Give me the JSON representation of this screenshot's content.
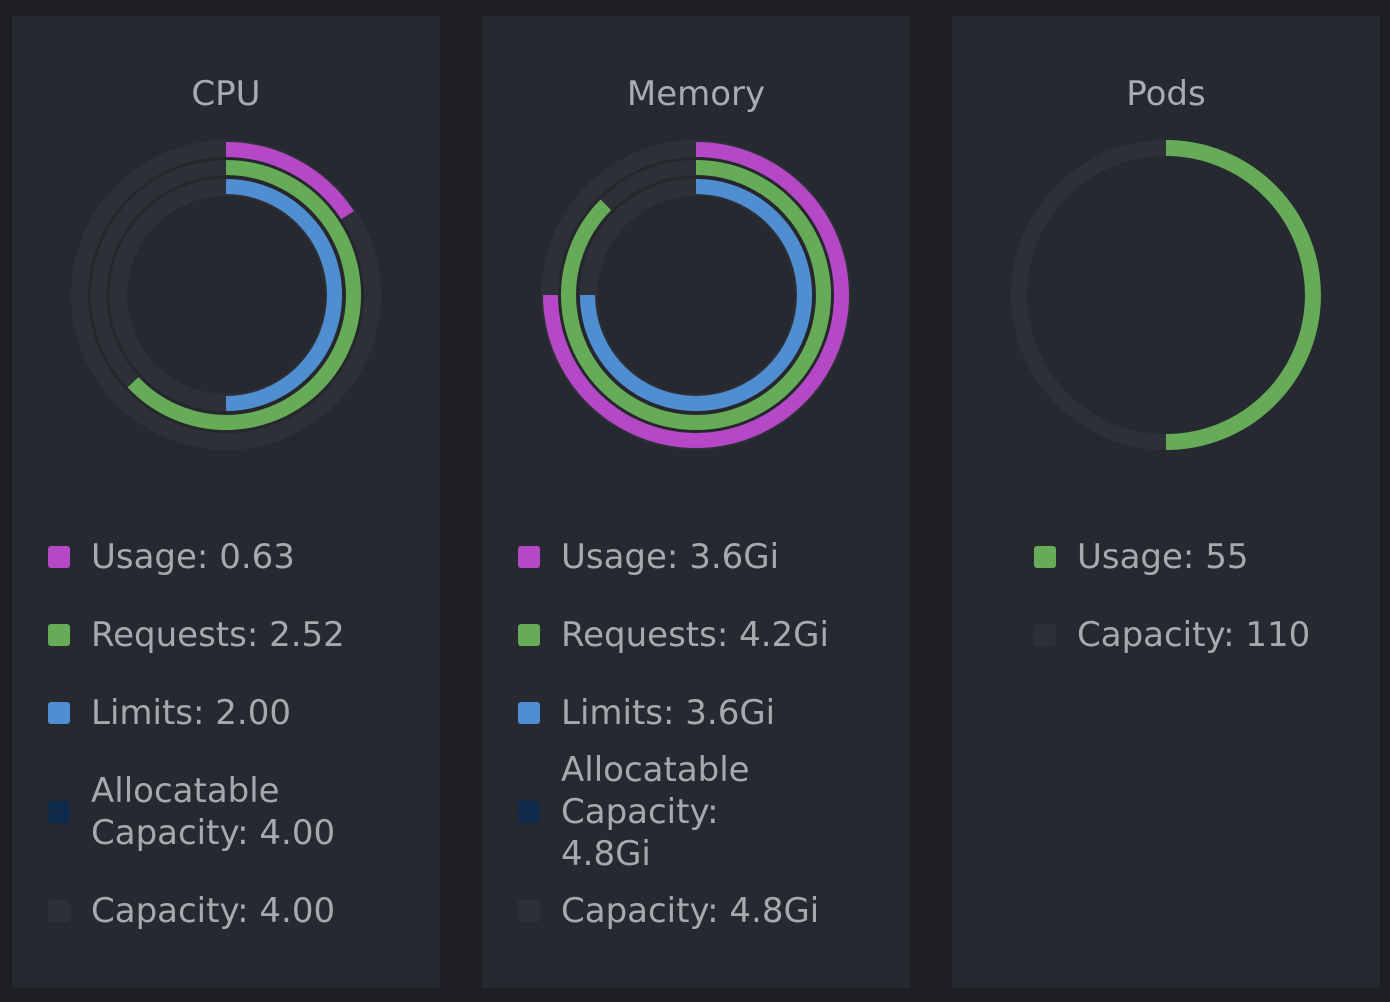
{
  "colors": {
    "usage": "#b548c6",
    "requests": "#66ab58",
    "limits": "#4f8fd1",
    "allocatable": "#0f2a4b",
    "capacity": "#2d3036"
  },
  "panels": [
    {
      "title": "CPU",
      "rings": [
        {
          "metric": "usage",
          "fraction": 0.1575
        },
        {
          "metric": "requests",
          "fraction": 0.63
        },
        {
          "metric": "limits",
          "fraction": 0.5
        }
      ],
      "legend": [
        {
          "metric": "usage",
          "text": "Usage: 0.63"
        },
        {
          "metric": "requests",
          "text": "Requests: 2.52"
        },
        {
          "metric": "limits",
          "text": "Limits: 2.00"
        },
        {
          "metric": "allocatable",
          "text": "Allocatable Capacity: 4.00"
        },
        {
          "metric": "capacity",
          "text": "Capacity: 4.00"
        }
      ]
    },
    {
      "title": "Memory",
      "rings": [
        {
          "metric": "usage",
          "fraction": 0.75
        },
        {
          "metric": "requests",
          "fraction": 0.875
        },
        {
          "metric": "limits",
          "fraction": 0.75
        }
      ],
      "legend": [
        {
          "metric": "usage",
          "text": "Usage: 3.6Gi"
        },
        {
          "metric": "requests",
          "text": "Requests: 4.2Gi"
        },
        {
          "metric": "limits",
          "text": "Limits: 3.6Gi"
        },
        {
          "metric": "allocatable",
          "text": "Allocatable Capacity: 4.8Gi"
        },
        {
          "metric": "capacity",
          "text": "Capacity: 4.8Gi"
        }
      ]
    },
    {
      "title": "Pods",
      "rings": [
        {
          "metric": "requests",
          "fraction": 0.5
        }
      ],
      "legend": [
        {
          "metric": "requests",
          "text": "Usage: 55"
        },
        {
          "metric": "capacity",
          "text": "Capacity: 110"
        }
      ]
    }
  ]
}
